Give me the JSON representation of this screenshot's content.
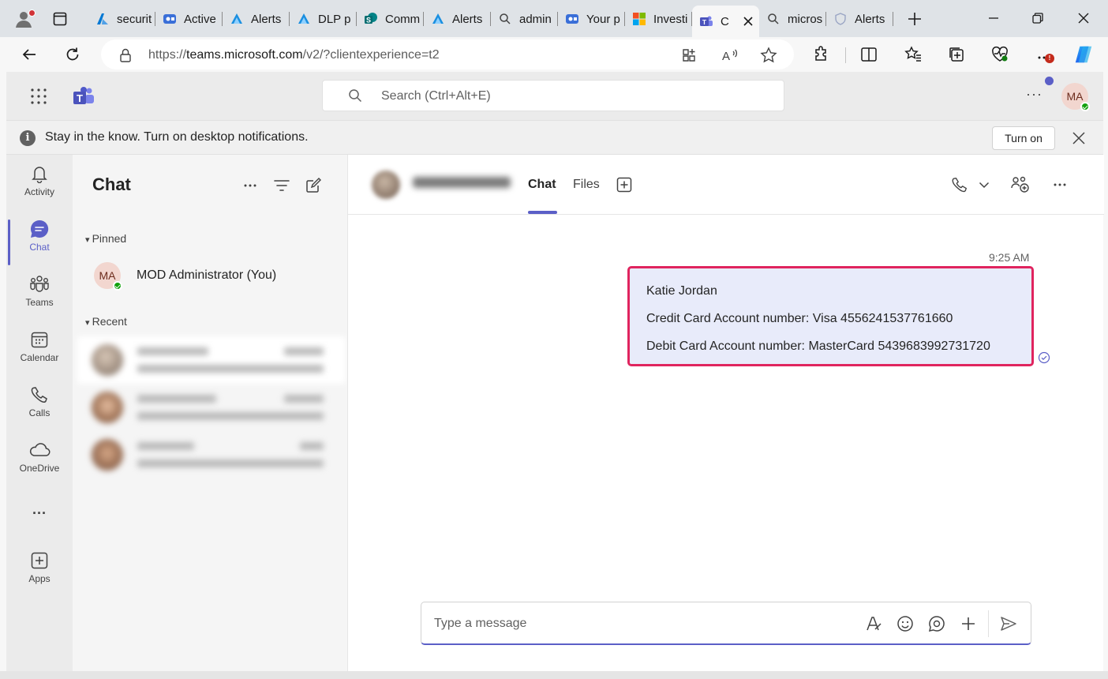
{
  "browser": {
    "tabs": [
      {
        "label": "securit",
        "icon": "azure-icon"
      },
      {
        "label": "Active",
        "icon": "directory-icon"
      },
      {
        "label": "Alerts",
        "icon": "azure-icon"
      },
      {
        "label": "DLP p",
        "icon": "azure-icon"
      },
      {
        "label": "Comm",
        "icon": "sharepoint-icon"
      },
      {
        "label": "Alerts",
        "icon": "azure-icon"
      },
      {
        "label": "admin",
        "icon": "search-icon"
      },
      {
        "label": "Your p",
        "icon": "directory-icon"
      },
      {
        "label": "Investi",
        "icon": "microsoft-logo-icon"
      },
      {
        "label": "C",
        "icon": "teams-icon"
      },
      {
        "label": "micros",
        "icon": "search-icon"
      },
      {
        "label": "Alerts",
        "icon": "shield-icon"
      }
    ],
    "address": {
      "scheme": "https://",
      "host": "teams.microsoft.com",
      "path": "/v2/?clientexperience=t2"
    }
  },
  "teams": {
    "search_placeholder": "Search (Ctrl+Alt+E)",
    "user_initials": "MA",
    "accent_color": "#5b5fc7"
  },
  "banner": {
    "message": "Stay in the know. Turn on desktop notifications.",
    "button_label": "Turn on"
  },
  "rail": [
    {
      "label": "Activity",
      "icon": "bell-icon"
    },
    {
      "label": "Chat",
      "icon": "chat-icon"
    },
    {
      "label": "Teams",
      "icon": "teams-people-icon"
    },
    {
      "label": "Calendar",
      "icon": "calendar-icon"
    },
    {
      "label": "Calls",
      "icon": "phone-icon"
    },
    {
      "label": "OneDrive",
      "icon": "cloud-icon"
    },
    {
      "label": "...",
      "icon": "more-icon"
    },
    {
      "label": "Apps",
      "icon": "add-square-icon"
    }
  ],
  "chatlist": {
    "title": "Chat",
    "pinned_header": "Pinned",
    "recent_header": "Recent",
    "pinned": [
      {
        "initials": "MA",
        "name": "MOD Administrator (You)"
      }
    ]
  },
  "conversation": {
    "tab_chat": "Chat",
    "tab_files": "Files",
    "message": {
      "time": "9:25 AM",
      "lines": [
        "Katie Jordan",
        "Credit Card Account number: Visa 4556241537761660",
        "Debit Card Account number: MasterCard 5439683992731720"
      ],
      "highlight_color": "#e0245e"
    },
    "compose_placeholder": "Type a message"
  }
}
